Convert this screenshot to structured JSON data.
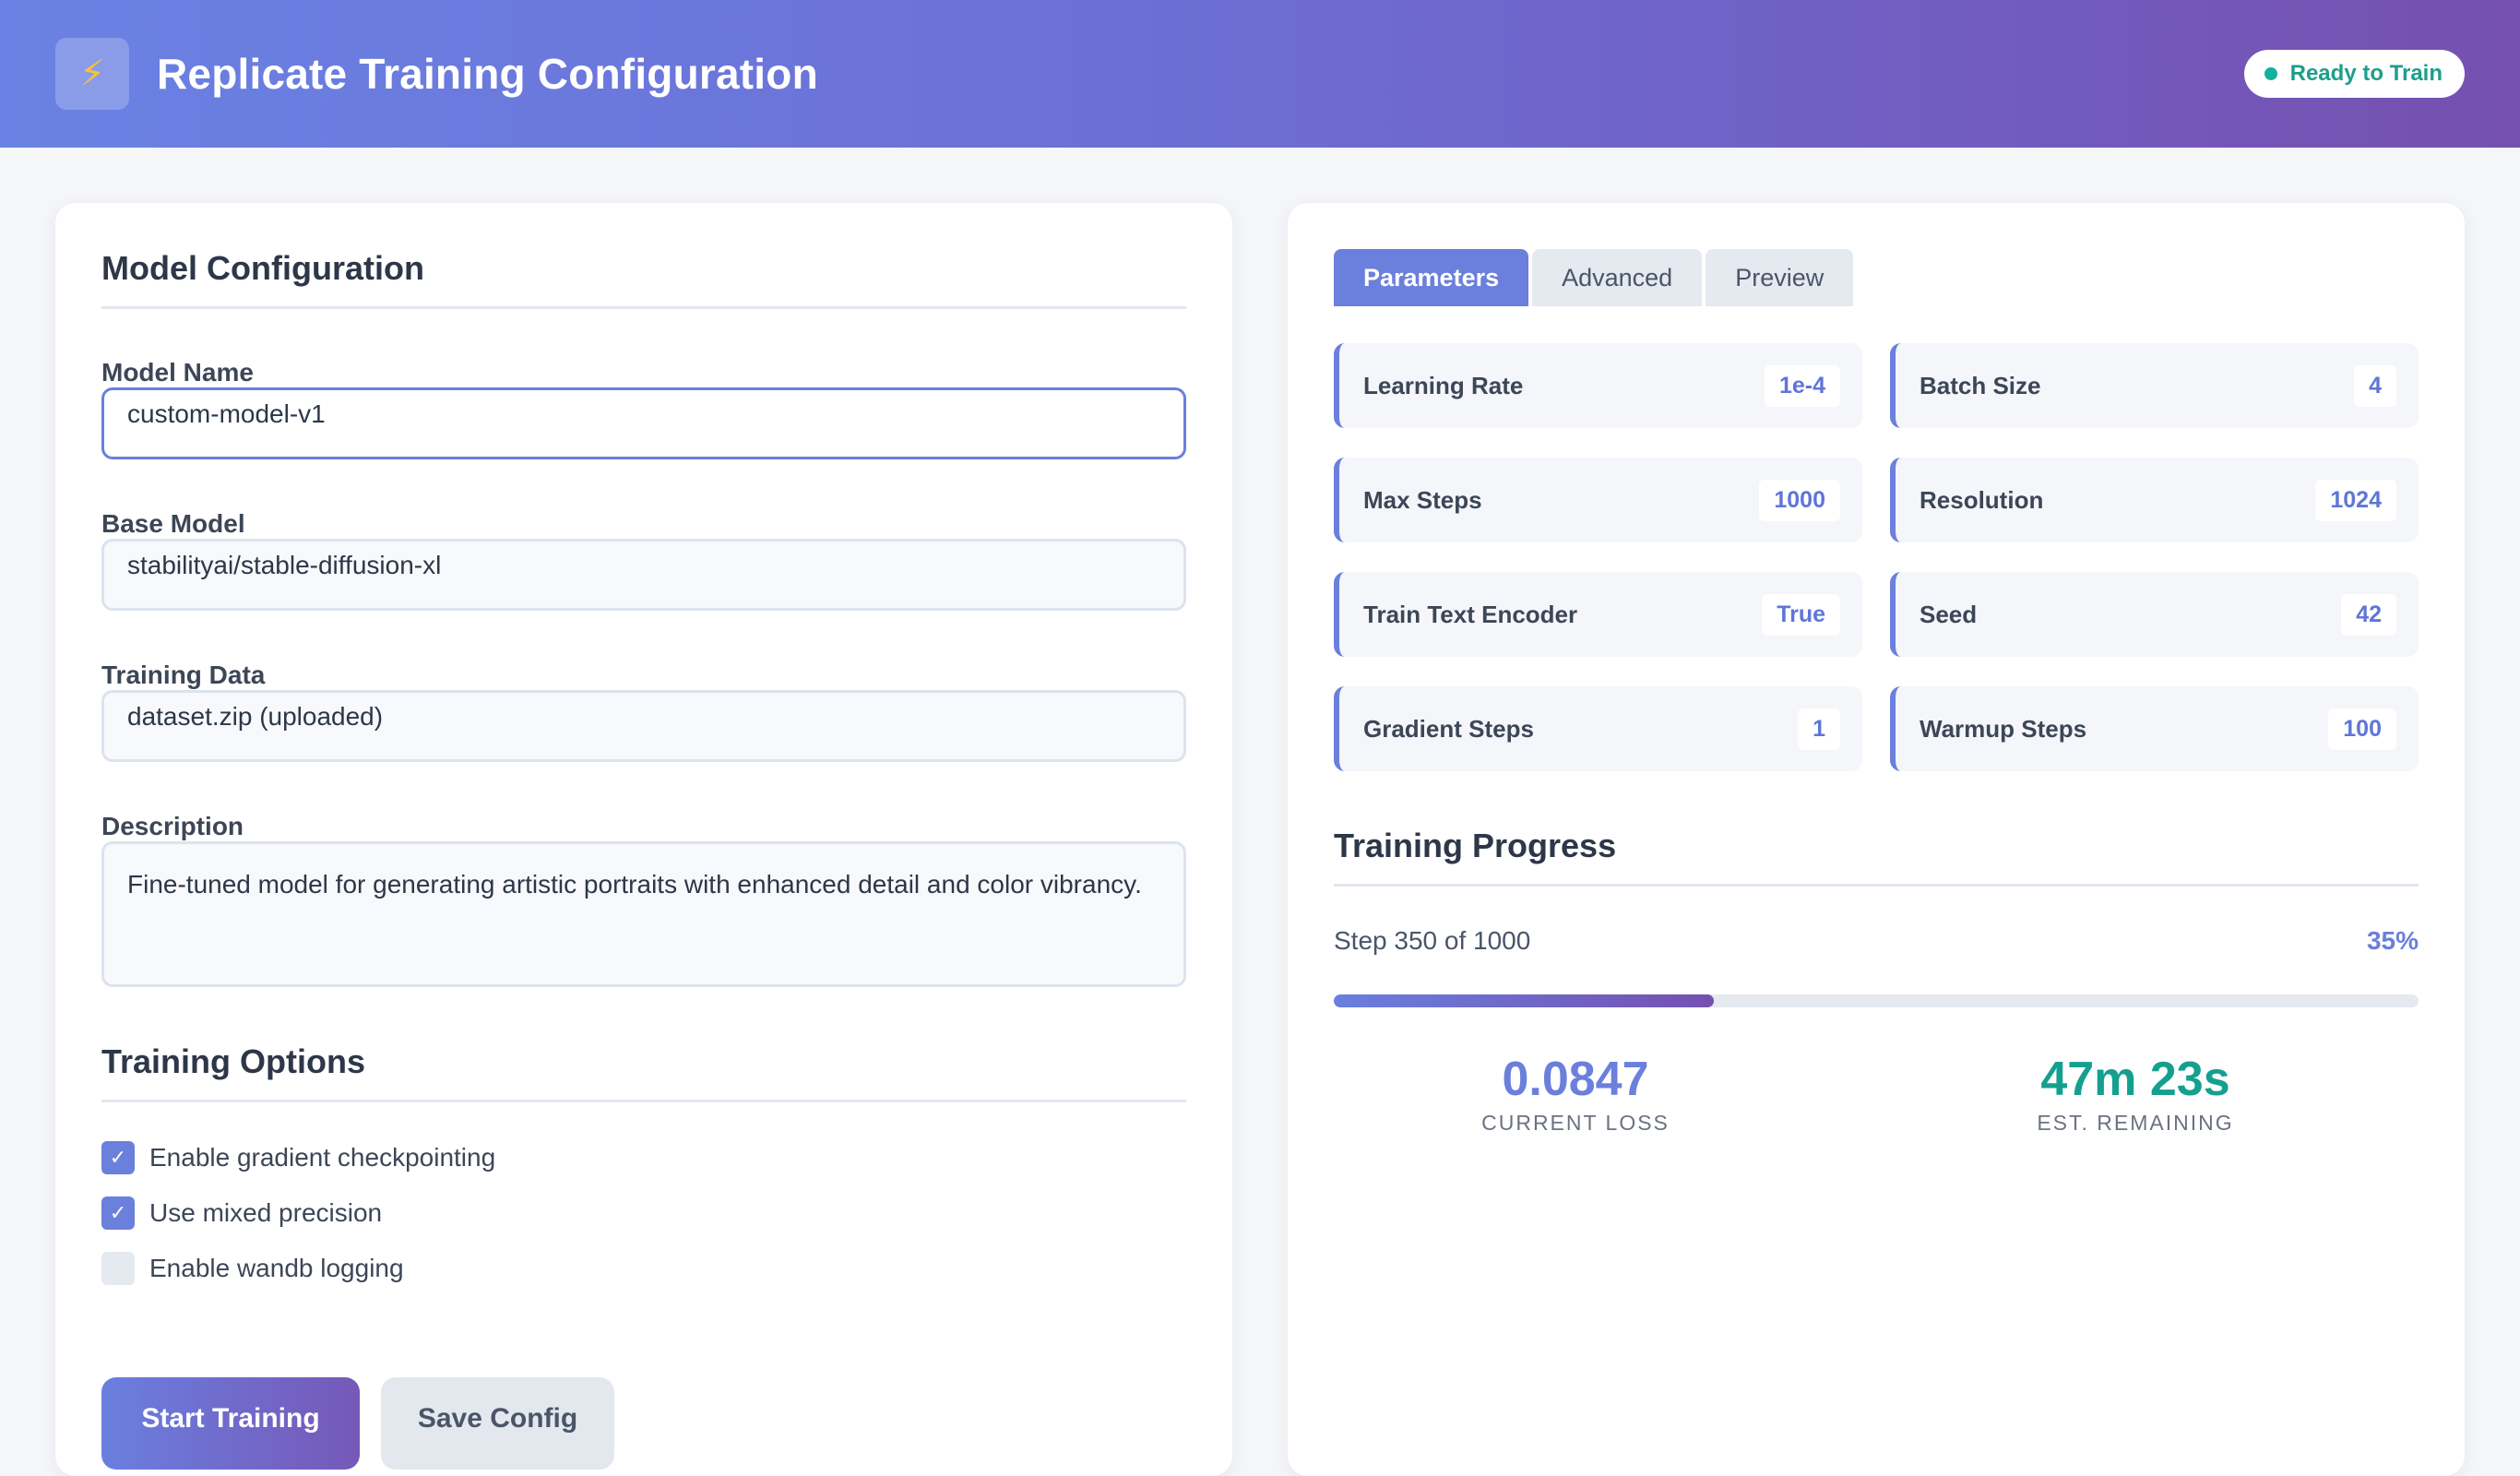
{
  "header": {
    "title": "Replicate Training Configuration",
    "logo_icon": "lightning-icon",
    "status": "Ready to Train"
  },
  "colors": {
    "accent": "#6b7fdc",
    "header_start": "#6a82e3",
    "header_end": "#7550b0",
    "status_green": "#10b39a",
    "teal_metric": "#14a08f"
  },
  "model_config": {
    "title": "Model Configuration",
    "fields": {
      "model_name": {
        "label": "Model Name",
        "value": "custom-model-v1"
      },
      "base_model": {
        "label": "Base Model",
        "value": "stabilityai/stable-diffusion-xl"
      },
      "training_data": {
        "label": "Training Data",
        "value": "dataset.zip (uploaded)"
      },
      "description": {
        "label": "Description",
        "value": "Fine-tuned model for generating artistic portraits with enhanced detail and color vibrancy."
      }
    }
  },
  "training_options": {
    "title": "Training Options",
    "options": [
      {
        "label": "Enable gradient checkpointing",
        "checked": true
      },
      {
        "label": "Use mixed precision",
        "checked": true
      },
      {
        "label": "Enable wandb logging",
        "checked": false
      }
    ]
  },
  "actions": {
    "start": "Start Training",
    "save": "Save Config"
  },
  "tabs": [
    {
      "label": "Parameters",
      "active": true
    },
    {
      "label": "Advanced",
      "active": false
    },
    {
      "label": "Preview",
      "active": false
    }
  ],
  "parameters": [
    {
      "label": "Learning Rate",
      "value": "1e-4"
    },
    {
      "label": "Batch Size",
      "value": "4"
    },
    {
      "label": "Max Steps",
      "value": "1000"
    },
    {
      "label": "Resolution",
      "value": "1024"
    },
    {
      "label": "Train Text Encoder",
      "value": "True"
    },
    {
      "label": "Seed",
      "value": "42"
    },
    {
      "label": "Gradient Steps",
      "value": "1"
    },
    {
      "label": "Warmup Steps",
      "value": "100"
    }
  ],
  "progress": {
    "title": "Training Progress",
    "step_text": "Step 350 of 1000",
    "percent_text": "35%",
    "fraction": 0.35,
    "loss_value": "0.0847",
    "loss_label": "CURRENT LOSS",
    "remaining_value": "47m 23s",
    "remaining_label": "EST. REMAINING"
  }
}
